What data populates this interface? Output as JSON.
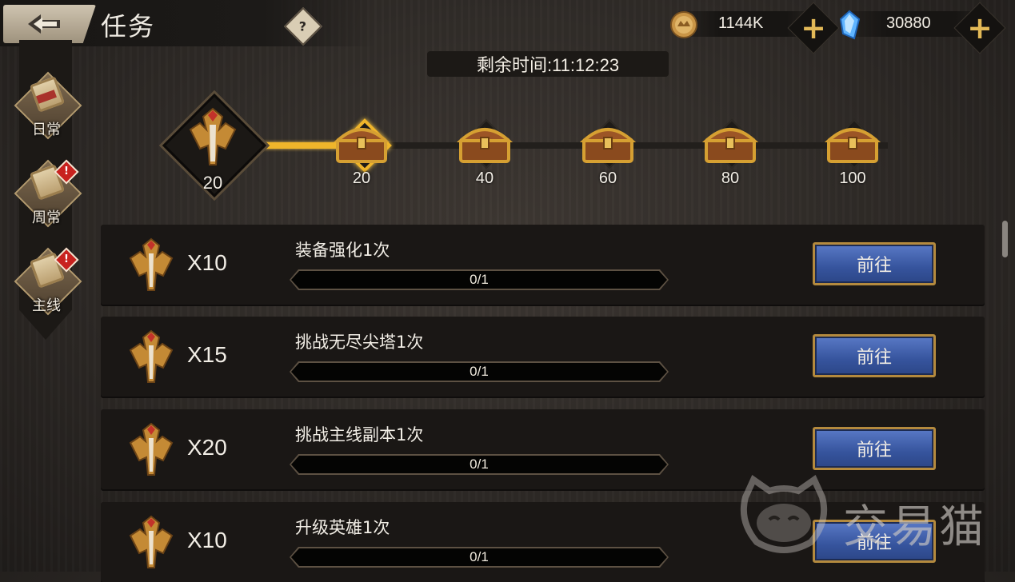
{
  "header": {
    "title": "任务",
    "help_label": "?"
  },
  "currencies": {
    "gold": {
      "value": "1144K",
      "icon": "gold-coin-icon"
    },
    "diamond": {
      "value": "30880",
      "icon": "blue-crystal-icon"
    },
    "plus_label": "+"
  },
  "timer": {
    "text": "剩余时间:11:12:23"
  },
  "side_tabs": [
    {
      "label": "日常",
      "badge": ""
    },
    {
      "label": "周常",
      "badge": "!"
    },
    {
      "label": "主线",
      "badge": "!"
    }
  ],
  "progress": {
    "current_points": "20",
    "milestones": [
      {
        "value": "20",
        "active": true
      },
      {
        "value": "40",
        "active": false
      },
      {
        "value": "60",
        "active": false
      },
      {
        "value": "80",
        "active": false
      },
      {
        "value": "100",
        "active": false
      }
    ]
  },
  "tasks": [
    {
      "reward": "X10",
      "title": "装备强化1次",
      "progress": "0/1",
      "button": "前往"
    },
    {
      "reward": "X15",
      "title": "挑战无尽尖塔1次",
      "progress": "0/1",
      "button": "前往"
    },
    {
      "reward": "X20",
      "title": "挑战主线副本1次",
      "progress": "0/1",
      "button": "前往"
    },
    {
      "reward": "X10",
      "title": "升级英雄1次",
      "progress": "0/1",
      "button": "前往"
    }
  ],
  "watermark": {
    "text": "交易猫"
  },
  "colors": {
    "accent_gold": "#efb52b",
    "button_blue": "#36549d",
    "badge_red": "#c8221f"
  }
}
